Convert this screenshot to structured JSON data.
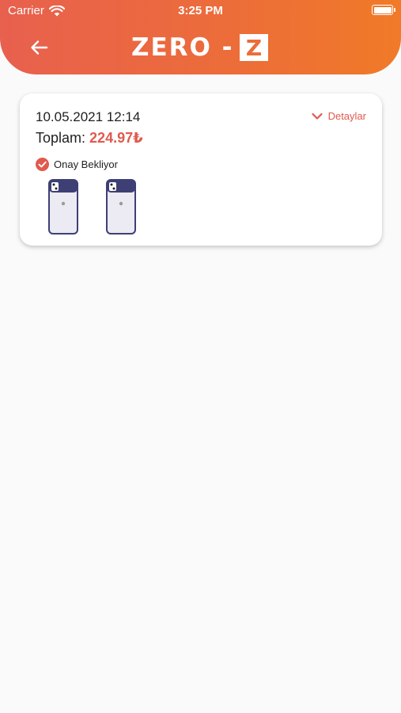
{
  "status_bar": {
    "carrier": "Carrier",
    "time": "3:25 PM"
  },
  "header": {
    "logo_text": "ZERO -",
    "logo_mark": "Z"
  },
  "order": {
    "date": "10.05.2021 12:14",
    "details_label": "Detaylar",
    "total_label": "Toplam:",
    "total_value": "224.97₺",
    "status": "Onay Bekliyor",
    "products": [
      {
        "name": "phone-case-1"
      },
      {
        "name": "phone-case-2"
      }
    ]
  },
  "colors": {
    "accent": "#e05a4e",
    "header_start": "#e8604e",
    "header_end": "#f07a28",
    "case_top": "#3d3f75"
  }
}
